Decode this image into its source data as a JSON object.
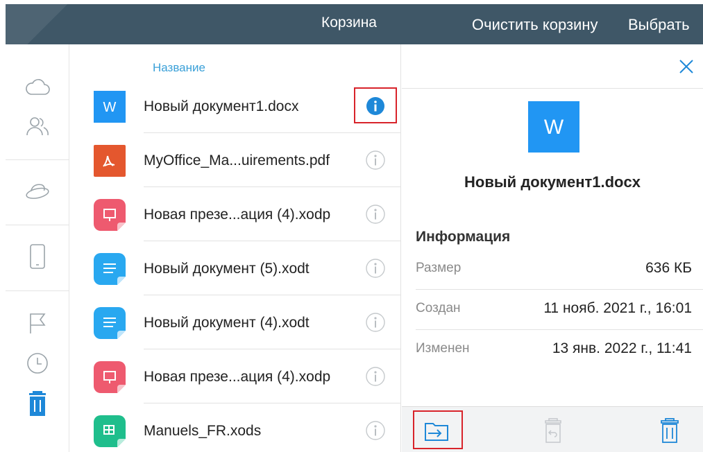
{
  "header": {
    "title": "Корзина",
    "clear_label": "Очистить корзину",
    "select_label": "Выбрать"
  },
  "rail": {
    "items": [
      {
        "icon": "cloud-icon"
      },
      {
        "icon": "users-icon"
      },
      {
        "icon": "hat-icon"
      },
      {
        "icon": "tablet-icon"
      },
      {
        "icon": "flag-icon"
      },
      {
        "icon": "clock-icon"
      },
      {
        "icon": "trash-icon",
        "active": true
      }
    ]
  },
  "list": {
    "column_header": "Название",
    "files": [
      {
        "name": "Новый документ1.docx",
        "icon": "word-file-icon",
        "selected": true
      },
      {
        "name": "MyOffice_Ma...uirements.pdf",
        "icon": "pdf-file-icon"
      },
      {
        "name": "Новая презе...ация (4).xodp",
        "icon": "presentation-file-icon"
      },
      {
        "name": "Новый документ (5).xodt",
        "icon": "text-document-file-icon"
      },
      {
        "name": "Новый документ (4).xodt",
        "icon": "text-document-file-icon"
      },
      {
        "name": "Новая презе...ация (4).xodp",
        "icon": "presentation-file-icon"
      },
      {
        "name": "Manuels_FR.xods",
        "icon": "spreadsheet-file-icon"
      }
    ]
  },
  "details": {
    "file_name": "Новый документ1.docx",
    "file_icon_letter": "W",
    "section_title": "Информация",
    "size_label": "Размер",
    "size_value": "636 КБ",
    "created_label": "Создан",
    "created_value": "11 нояб. 2021 г., 16:01",
    "modified_label": "Изменен",
    "modified_value": "13 янв. 2022 г., 11:41"
  },
  "colors": {
    "header_bg": "#3f5767",
    "accent": "#1e88d8",
    "link": "#3aa0d8",
    "highlight": "#d8232a",
    "word": "#2196f3",
    "pdf": "#e4572e",
    "presentation": "#ee5a6f",
    "text_doc": "#29a8f0",
    "spreadsheet": "#1fbe8c"
  }
}
